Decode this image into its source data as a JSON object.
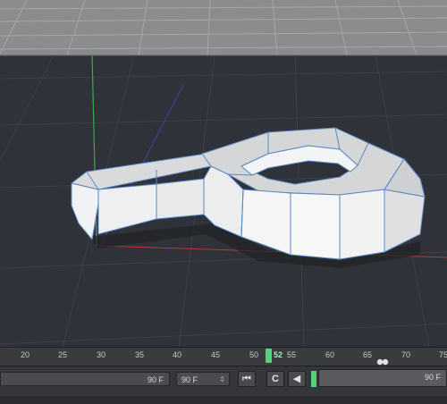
{
  "timeline": {
    "ticks": [
      "20",
      "25",
      "30",
      "35",
      "40",
      "45",
      "50",
      "55",
      "60",
      "65",
      "70",
      "75"
    ],
    "current_frame": "52"
  },
  "transport": {
    "preview_min_value": "90 F",
    "frame_field_value": "90 F",
    "preview_max_value": "90 F",
    "buttons": {
      "goto_start": "⏮",
      "loop": "C",
      "prev_key": "◀"
    }
  },
  "colors": {
    "viewport_bg": "#2f3238",
    "floor": "#8e8e8e",
    "mesh_face": "#e9eaec",
    "mesh_edge": "#5b88c2",
    "y_axis": "#3ea846",
    "x_axis": "#b43a3a",
    "z_axis": "#3b4aa0",
    "playhead": "#56d17e"
  },
  "icons": {
    "goto_start": "skip-to-start-icon",
    "loop": "loop-icon",
    "prev_key": "previous-key-icon",
    "marker": "ghost-marker-icon"
  }
}
